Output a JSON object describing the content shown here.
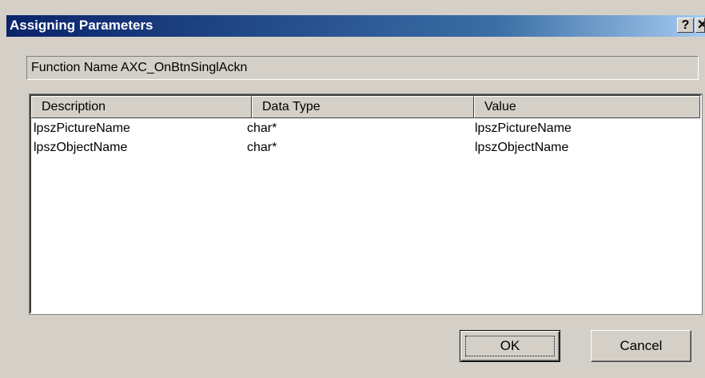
{
  "window": {
    "title": "Assigning Parameters",
    "help_label": "?",
    "close_label": "✕"
  },
  "function_name": {
    "text": "Function Name AXC_OnBtnSinglAckn"
  },
  "list": {
    "columns": [
      "Description",
      "Data Type",
      "Value"
    ],
    "rows": [
      {
        "description": "lpszPictureName",
        "data_type": "char*",
        "value": "lpszPictureName"
      },
      {
        "description": "lpszObjectName",
        "data_type": "char*",
        "value": "lpszObjectName"
      }
    ]
  },
  "buttons": {
    "ok_label": "OK",
    "cancel_label": "Cancel"
  },
  "colors": {
    "titlebar_start": "#0a246a",
    "titlebar_end": "#a6caf0",
    "face": "#d4d0c8"
  },
  "icons": {
    "help": "help-icon",
    "close": "close-icon"
  }
}
